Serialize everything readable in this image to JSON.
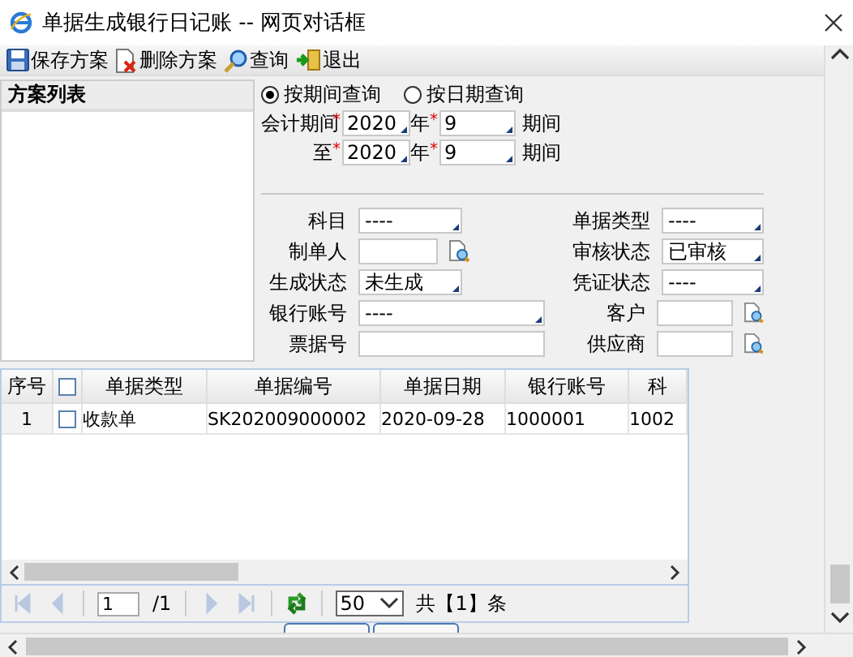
{
  "window": {
    "title": "单据生成银行日记账 -- 网页对话框"
  },
  "toolbar": {
    "buttons": [
      {
        "kind": "save",
        "label": "保存方案"
      },
      {
        "kind": "delete",
        "label": "删除方案"
      },
      {
        "kind": "search",
        "label": "查询"
      },
      {
        "kind": "exit",
        "label": "退出"
      }
    ]
  },
  "scheme_list": {
    "title": "方案列表"
  },
  "query_mode": [
    {
      "label": "按期间查询",
      "selected": true
    },
    {
      "label": "按日期查询",
      "selected": false
    }
  ],
  "periods": [
    {
      "label": "会计期间",
      "mark": "*",
      "year": "2020",
      "year_label": "年",
      "year_mark": "*",
      "period": "9",
      "unit": "期间"
    },
    {
      "label": "至",
      "mark": "*",
      "year": "2020",
      "year_label": "年",
      "year_mark": "*",
      "period": "9",
      "unit": "期间"
    }
  ],
  "filters_left": [
    {
      "label": "科目",
      "kind": "select",
      "value": "----"
    },
    {
      "label": "制单人",
      "kind": "lookup"
    },
    {
      "label": "生成状态",
      "kind": "select",
      "value": "未生成"
    },
    {
      "label": "银行账号",
      "kind": "wide-select",
      "value": "----"
    },
    {
      "label": "票据号",
      "kind": "wide-text"
    }
  ],
  "filters_right": [
    {
      "label": "单据类型",
      "kind": "select",
      "value": "----"
    },
    {
      "label": "审核状态",
      "kind": "select",
      "value": "已审核"
    },
    {
      "label": "凭证状态",
      "kind": "select",
      "value": "----"
    },
    {
      "label": "客户",
      "kind": "lookup"
    },
    {
      "label": "供应商",
      "kind": "lookup"
    }
  ],
  "table": {
    "columns": [
      "序号",
      "单据类型",
      "单据编号",
      "单据日期",
      "银行账号",
      "科"
    ],
    "all_checked": false,
    "rows": [
      {
        "cells": [
          "1",
          "收款单",
          "SK202009000002",
          "2020-09-28",
          "1000001",
          "1002"
        ],
        "checked": false
      }
    ]
  },
  "pager": {
    "nav": [
      {
        "kind": "first",
        "disabled": true
      },
      {
        "kind": "prev",
        "disabled": true
      },
      {
        "kind": "next",
        "disabled": true
      },
      {
        "kind": "last",
        "disabled": true
      }
    ],
    "page": "1",
    "pages": "/1",
    "page_size": "50",
    "total": "共【1】条"
  }
}
